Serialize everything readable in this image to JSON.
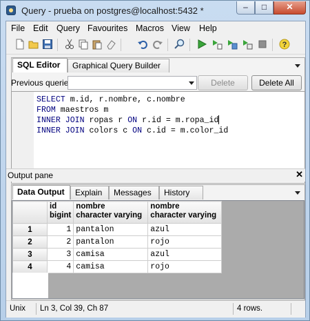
{
  "window": {
    "title": "Query - prueba on postgres@localhost:5432 *",
    "close_glyph": "✕",
    "max_glyph": "□",
    "min_glyph": "–"
  },
  "menu": [
    "File",
    "Edit",
    "Query",
    "Favourites",
    "Macros",
    "View",
    "Help"
  ],
  "toolbar_icons": [
    "new-file-icon",
    "open-folder-icon",
    "save-icon",
    "cut-icon",
    "copy-icon",
    "paste-icon",
    "clear-icon",
    "undo-icon",
    "redo-icon",
    "find-icon",
    "execute-icon",
    "explain-icon",
    "execute-to-file-icon",
    "execute-pgscript-icon",
    "stop-icon",
    "help-icon"
  ],
  "editor_tabs": {
    "sql_editor": "SQL Editor",
    "graphical": "Graphical Query Builder"
  },
  "previous_queries": {
    "label": "Previous queries",
    "delete": "Delete",
    "delete_all": "Delete All"
  },
  "sql": [
    {
      "kw1": "SELECT",
      "rest": " m.id, r.nombre, c.nombre"
    },
    {
      "kw1": "FROM",
      "rest": " maestros m"
    },
    {
      "kw1": "INNER JOIN",
      "rest": " ropas r ",
      "kw2": "ON",
      "rest2": " r.id = m.ropa_id"
    },
    {
      "kw1": "INNER JOIN",
      "rest": " colors c ",
      "kw2": "ON",
      "rest2": " c.id = m.color_id"
    }
  ],
  "output": {
    "pane_title": "Output pane",
    "close_glyph": "✕",
    "tabs": [
      "Data Output",
      "Explain",
      "Messages",
      "History"
    ],
    "columns": [
      {
        "name": "id",
        "type": "bigint"
      },
      {
        "name": "nombre",
        "type": "character varying"
      },
      {
        "name": "nombre",
        "type": "character varying"
      }
    ],
    "rows": [
      {
        "n": "1",
        "id": "1",
        "a": "pantalon",
        "b": "azul"
      },
      {
        "n": "2",
        "id": "2",
        "a": "pantalon",
        "b": "rojo"
      },
      {
        "n": "3",
        "id": "3",
        "a": "camisa",
        "b": "azul"
      },
      {
        "n": "4",
        "id": "4",
        "a": "camisa",
        "b": "rojo"
      }
    ]
  },
  "status": {
    "os": "Unix",
    "position": "Ln 3, Col 39, Ch 87",
    "rows": "4 rows."
  },
  "colors": {
    "keyword": "#00007f",
    "title_bar": "#b7cfe9",
    "close": "#c74b2f"
  }
}
